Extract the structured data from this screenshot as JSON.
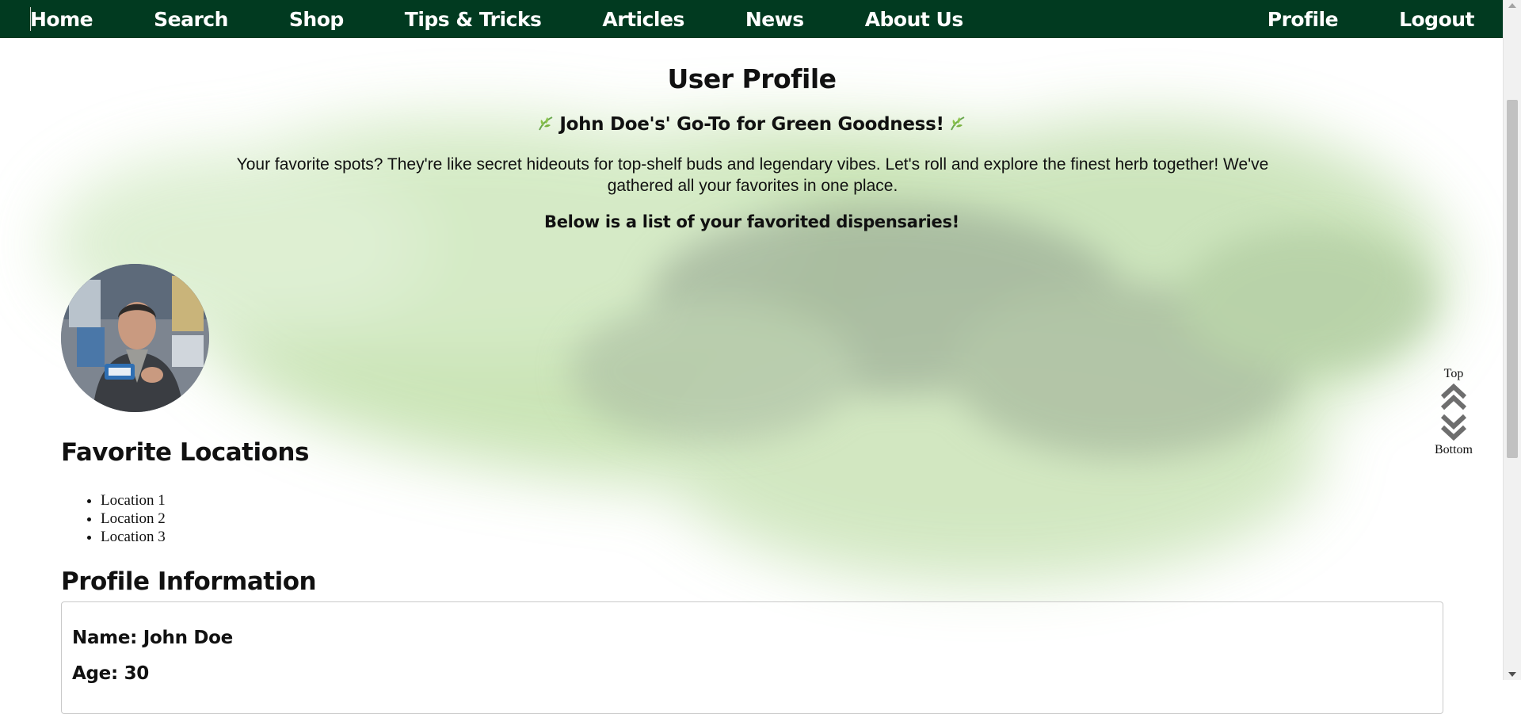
{
  "nav": {
    "left": [
      {
        "label": "Home"
      },
      {
        "label": "Search"
      },
      {
        "label": "Shop"
      },
      {
        "label": "Tips & Tricks"
      },
      {
        "label": "Articles"
      },
      {
        "label": "News"
      },
      {
        "label": "About Us"
      }
    ],
    "right": [
      {
        "label": "Profile"
      },
      {
        "label": "Logout"
      }
    ],
    "background_color": "#013a20"
  },
  "page": {
    "title": "User Profile",
    "tagline": "John Doe's' Go-To for Green Goodness!",
    "tagline_icon": "herb-leaf-icon",
    "intro": "Your favorite spots? They're like secret hideouts for top-shelf buds and legendary vibes. Let's roll and explore the finest herb together! We've gathered all your favorites in one place.",
    "below_note": "Below is a list of your favorited dispensaries!"
  },
  "avatar": {
    "icon": "user-avatar-photo"
  },
  "favorites": {
    "title": "Favorite Locations",
    "items": [
      "Location 1",
      "Location 2",
      "Location 3"
    ]
  },
  "profile_info": {
    "title": "Profile Information",
    "name_line": "Name: John Doe",
    "age_line": "Age: 30"
  },
  "scroll_nav": {
    "top_label": "Top",
    "bottom_label": "Bottom",
    "up_icon": "double-chevron-up-icon",
    "down_icon": "double-chevron-down-icon"
  },
  "colors": {
    "accent_green": "#8bc34a",
    "smoke_green": "#a9d38f"
  }
}
